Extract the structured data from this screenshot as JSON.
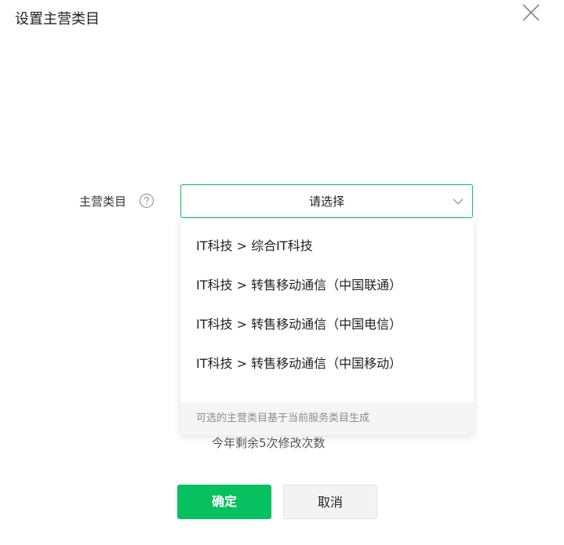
{
  "dialog": {
    "title": "设置主营类目",
    "close_icon": "close-icon"
  },
  "form": {
    "label": "主营类目",
    "help_icon": "question-circle-icon",
    "select": {
      "value": "请选择",
      "chevron_icon": "chevron-down-icon",
      "accent_color": "#07c160"
    },
    "dropdown": {
      "options": [
        "IT科技 > 综合IT科技",
        "IT科技 > 转售移动通信（中国联通）",
        "IT科技 > 转售移动通信（中国电信）",
        "IT科技 > 转售移动通信（中国移动）"
      ],
      "footer": "可选的主营类目基于当前服务类目生成"
    },
    "remaining": "今年剩余5次修改次数"
  },
  "actions": {
    "confirm_label": "确定",
    "cancel_label": "取消",
    "confirm_color": "#07c160"
  }
}
